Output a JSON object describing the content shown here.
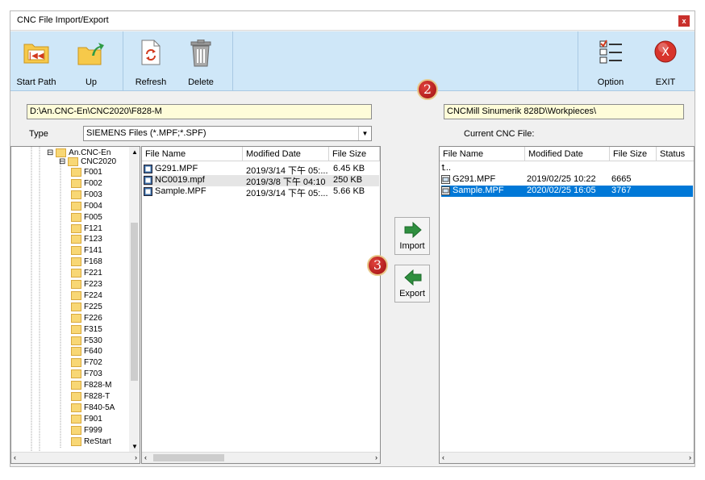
{
  "window": {
    "title": "CNC File Import/Export",
    "close": "x"
  },
  "toolbar": {
    "start_path": "Start Path",
    "up": "Up",
    "refresh": "Refresh",
    "delete": "Delete",
    "option": "Option",
    "exit": "EXIT"
  },
  "local": {
    "path": "D:\\An.CNC-En\\CNC2020\\F828-M",
    "type_label": "Type",
    "type_value": "SIEMENS Files (*.MPF;*.SPF)",
    "tree": {
      "root": "An.CNC-En",
      "sub": "CNC2020",
      "folders": [
        "F001",
        "F002",
        "F003",
        "F004",
        "F005",
        "F121",
        "F123",
        "F141",
        "F168",
        "F221",
        "F223",
        "F224",
        "F225",
        "F226",
        "F315",
        "F530",
        "F640",
        "F702",
        "F703",
        "F828-M",
        "F828-T",
        "F840-5A",
        "F901",
        "F999",
        "ReStart"
      ]
    },
    "columns": [
      "File Name",
      "Modified Date",
      "File Size"
    ],
    "files": [
      {
        "name": "G291.MPF",
        "date": "2019/3/14 下午 05:...",
        "size": "6.45 KB"
      },
      {
        "name": "NC0019.mpf",
        "date": "2019/3/8 下午 04:10",
        "size": "250 KB"
      },
      {
        "name": "Sample.MPF",
        "date": "2019/3/14 下午 05:...",
        "size": "5.66 KB"
      }
    ]
  },
  "transfer": {
    "import": "Import",
    "export": "Export"
  },
  "remote": {
    "path": "CNCMill Sinumerik 828D\\Workpieces\\",
    "current_label": "Current CNC File:",
    "columns": [
      "File Name",
      "Modified Date",
      "File Size",
      "Status"
    ],
    "up_row": "..",
    "files": [
      {
        "name": "G291.MPF",
        "date": "2019/02/25 10:22",
        "size": "6665"
      },
      {
        "name": "Sample.MPF",
        "date": "2020/02/25 16:05",
        "size": "3767"
      }
    ]
  },
  "badges": {
    "two": "2",
    "three": "3"
  },
  "colors": {
    "toolbar_bg": "#cfe7f8",
    "path_field_bg": "#fefcd9",
    "selection": "#0078d7",
    "badge": "#c0181b"
  }
}
